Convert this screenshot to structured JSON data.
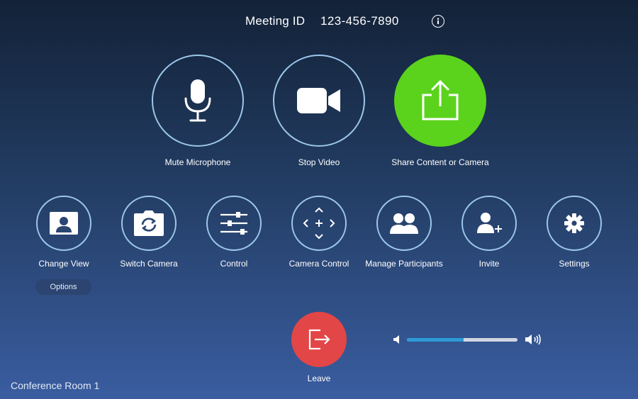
{
  "header": {
    "meeting_id_label": "Meeting ID",
    "meeting_id_value": "123-456-7890"
  },
  "primary_controls": [
    {
      "label": "Mute Microphone",
      "icon": "microphone-icon"
    },
    {
      "label": "Stop Video",
      "icon": "video-camera-icon"
    },
    {
      "label": "Share Content or Camera",
      "icon": "share-upload-icon"
    }
  ],
  "secondary_controls": [
    {
      "label": "Change View",
      "icon": "user-frame-icon"
    },
    {
      "label": "Switch Camera",
      "icon": "switch-camera-icon"
    },
    {
      "label": "Control",
      "icon": "sliders-icon"
    },
    {
      "label": "Camera Control",
      "icon": "directional-pad-icon"
    },
    {
      "label": "Manage Participants",
      "icon": "participants-icon"
    },
    {
      "label": "Invite",
      "icon": "add-user-icon"
    },
    {
      "label": "Settings",
      "icon": "gear-icon"
    }
  ],
  "options_label": "Options",
  "leave_label": "Leave",
  "volume": {
    "level": 0.51
  },
  "room_name": "Conference Room 1",
  "colors": {
    "share_green": "#5bd31c",
    "leave_red": "#e24646",
    "ring_blue": "#9cc7ea",
    "volume_fill": "#2d9ad6"
  }
}
